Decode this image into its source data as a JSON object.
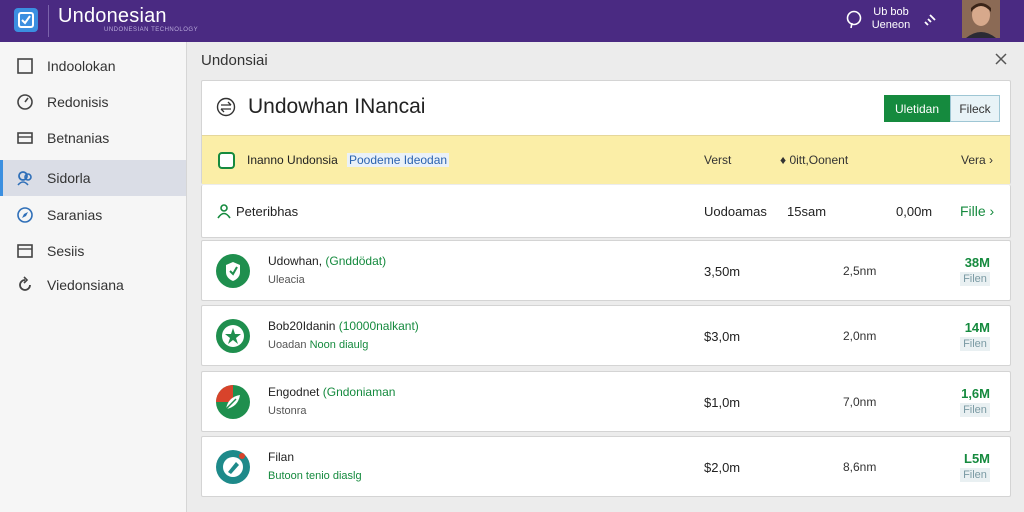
{
  "app": {
    "title": "Undonesian",
    "subtitle": "UNDONESIAN TECHNOLOGY",
    "user_line1": "Ub bob",
    "user_line2": "Ueneon"
  },
  "icons": {
    "brand": "checklist-icon",
    "help": "help-icon",
    "link": "link-icon",
    "close": "close-icon"
  },
  "sidebar": {
    "items": [
      {
        "label": "Indoolokan",
        "icon": "square-icon",
        "active": false
      },
      {
        "label": "Redonisis",
        "icon": "gauge-icon",
        "active": false
      },
      {
        "label": "Betnanias",
        "icon": "card-icon",
        "active": false
      },
      {
        "label": "Sidorla",
        "icon": "users-icon",
        "active": true
      },
      {
        "label": "Saranias",
        "icon": "compass-icon",
        "active": false
      },
      {
        "label": "Sesiis",
        "icon": "window-icon",
        "active": false
      },
      {
        "label": "Viedonsiana",
        "icon": "refresh-icon",
        "active": false
      }
    ]
  },
  "panel": {
    "title": "Undonsiai",
    "header_title": "Undowhan INancai",
    "btn_primary": "Uletidan",
    "btn_secondary": "Fileck"
  },
  "banner": {
    "text": "Inanno Undonsia",
    "link": "Poodeme Ideodan",
    "col1": "Verst",
    "col2": "♦ 0itt,Oonent",
    "col3": "Vera ›"
  },
  "summary": {
    "label": "Peteribhas",
    "col1": "Uodoamas",
    "col2": "15sam",
    "col3": "0,00m",
    "col4": "Fille ›"
  },
  "items": [
    {
      "name": "Udowhan,",
      "name_paren": "(Gnddödat)",
      "sub": "Uleacia",
      "sub_green": "",
      "col1": "3,50m",
      "col2": "2,5nm",
      "value": "38M",
      "badge": "Filen",
      "logo_color": "#1f8f4e",
      "logo_icon": "shield-icon"
    },
    {
      "name": "Bob20Idanin",
      "name_paren": "(10000nalkant)",
      "sub": "Uoadan ",
      "sub_green": "Noon diaulg",
      "col1": "$3,0m",
      "col2": "2,0nm",
      "value": "14M",
      "badge": "Filen",
      "logo_color": "#1f8f4e",
      "logo_icon": "star-icon"
    },
    {
      "name": "Engodnet",
      "name_paren": "(Gndoniaman",
      "sub": "Ustonra",
      "sub_green": "",
      "col1": "$1,0m",
      "col2": "7,0nm",
      "value": "1,6M",
      "badge": "Filen",
      "logo_color": "#1f8f4e",
      "logo_icon": "leaf-icon"
    },
    {
      "name": "Filan",
      "name_paren": "",
      "sub": "",
      "sub_green": "Butoon tenio diaslg",
      "col1": "$2,0m",
      "col2": "8,6nm",
      "value": "L5M",
      "badge": "Filen",
      "logo_color": "#1e8a8a",
      "logo_icon": "pen-icon"
    }
  ]
}
